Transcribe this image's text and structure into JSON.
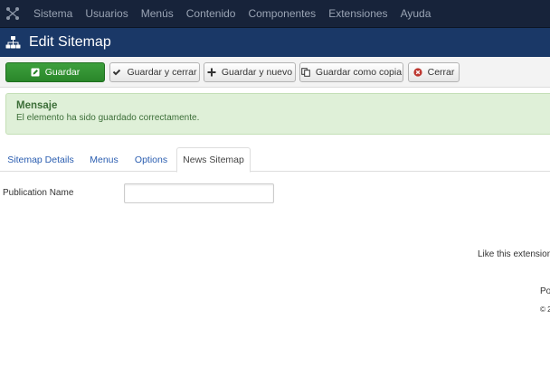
{
  "topnav": {
    "items": [
      "Sistema",
      "Usuarios",
      "Menús",
      "Contenido",
      "Componentes",
      "Extensiones",
      "Ayuda"
    ]
  },
  "header": {
    "title": "Edit Sitemap"
  },
  "toolbar": {
    "save_label": "Guardar",
    "save_close_label": "Guardar y cerrar",
    "save_new_label": "Guardar y nuevo",
    "save_copy_label": "Guardar como copia",
    "close_label": "Cerrar"
  },
  "message": {
    "heading": "Mensaje",
    "text": "El elemento ha sido guardado correctamente."
  },
  "tabs": [
    {
      "label": "Sitemap Details"
    },
    {
      "label": "Menus"
    },
    {
      "label": "Options"
    },
    {
      "label": "News Sitemap",
      "active": true
    }
  ],
  "form": {
    "publication_name_label": "Publication Name",
    "publication_name_value": ""
  },
  "footer": {
    "promo": "Like this extension?",
    "powered": "Po",
    "copyright": "© 2"
  },
  "colors": {
    "topnav_bg": "#17233a",
    "titlebar_bg": "#1a3867",
    "primary_button": "#2f8f2f",
    "alert_bg": "#dff0d8",
    "link": "#2a5db0"
  },
  "icons": {
    "logo": "joomla-logo-icon",
    "title": "sitemap-icon",
    "save": "edit-icon",
    "save_close": "check-icon",
    "save_new": "plus-icon",
    "save_copy": "copy-icon",
    "close": "cancel-icon"
  }
}
